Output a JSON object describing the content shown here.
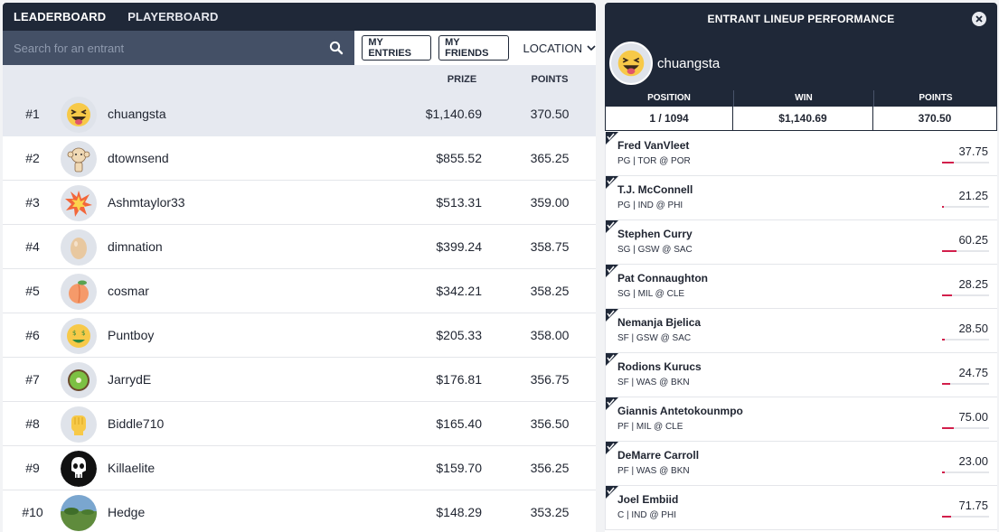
{
  "tabs": [
    {
      "label": "LEADERBOARD",
      "active": true
    },
    {
      "label": "PLAYERBOARD",
      "active": false
    }
  ],
  "search": {
    "placeholder": "Search for an entrant",
    "value": ""
  },
  "toolbar": {
    "my_entries": "MY ENTRIES",
    "my_friends": "MY FRIENDS",
    "location": "LOCATION"
  },
  "columns": {
    "prize": "PRIZE",
    "points": "POINTS"
  },
  "leaderboard": [
    {
      "rank": "#1",
      "name": "chuangsta",
      "prize": "$1,140.69",
      "points": "370.50",
      "avatar": "grinning-squint-tongue-emoji",
      "selected": true
    },
    {
      "rank": "#2",
      "name": "dtownsend",
      "prize": "$855.52",
      "points": "365.25",
      "avatar": "cartoon-character"
    },
    {
      "rank": "#3",
      "name": "Ashmtaylor33",
      "prize": "$513.31",
      "points": "359.00",
      "avatar": "explosion-emoji"
    },
    {
      "rank": "#4",
      "name": "dimnation",
      "prize": "$399.24",
      "points": "358.75",
      "avatar": "egg-emoji"
    },
    {
      "rank": "#5",
      "name": "cosmar",
      "prize": "$342.21",
      "points": "358.25",
      "avatar": "peach-emoji"
    },
    {
      "rank": "#6",
      "name": "Puntboy",
      "prize": "$205.33",
      "points": "358.00",
      "avatar": "money-mouth-emoji"
    },
    {
      "rank": "#7",
      "name": "JarrydE",
      "prize": "$176.81",
      "points": "356.75",
      "avatar": "kiwi-emoji"
    },
    {
      "rank": "#8",
      "name": "Biddle710",
      "prize": "$165.40",
      "points": "356.50",
      "avatar": "raised-fist-emoji"
    },
    {
      "rank": "#9",
      "name": "Killaelite",
      "prize": "$159.70",
      "points": "356.25",
      "avatar": "skull-logo"
    },
    {
      "rank": "#10",
      "name": "Hedge",
      "prize": "$148.29",
      "points": "353.25",
      "avatar": "landscape-photo"
    }
  ],
  "panel": {
    "title": "ENTRANT LINEUP PERFORMANCE",
    "user": "chuangsta",
    "stat_labels": {
      "position": "POSITION",
      "win": "WIN",
      "points": "POINTS"
    },
    "stats": {
      "position": "1 / 1094",
      "win": "$1,140.69",
      "points": "370.50"
    },
    "players": [
      {
        "name": "Fred VanVleet",
        "info": "PG | TOR @ POR",
        "points": "37.75",
        "progress": 0.25
      },
      {
        "name": "T.J. McConnell",
        "info": "PG | IND @ PHI",
        "points": "21.25",
        "progress": 0.03
      },
      {
        "name": "Stephen Curry",
        "info": "SG | GSW @ SAC",
        "points": "60.25",
        "progress": 0.3
      },
      {
        "name": "Pat Connaughton",
        "info": "SG | MIL @ CLE",
        "points": "28.25",
        "progress": 0.22
      },
      {
        "name": "Nemanja Bjelica",
        "info": "SF | GSW @ SAC",
        "points": "28.50",
        "progress": 0.06
      },
      {
        "name": "Rodions Kurucs",
        "info": "SF | WAS @ BKN",
        "points": "24.75",
        "progress": 0.18
      },
      {
        "name": "Giannis Antetokounmpo",
        "info": "PF | MIL @ CLE",
        "points": "75.00",
        "progress": 0.25
      },
      {
        "name": "DeMarre Carroll",
        "info": "PF | WAS @ BKN",
        "points": "23.00",
        "progress": 0.06
      },
      {
        "name": "Joel Embiid",
        "info": "C | IND @ PHI",
        "points": "71.75",
        "progress": 0.2
      }
    ]
  },
  "colors": {
    "navy": "#1f2838",
    "search_bg": "#445066",
    "selected_row": "#e6e9f0",
    "progress": "#d21f4b"
  }
}
